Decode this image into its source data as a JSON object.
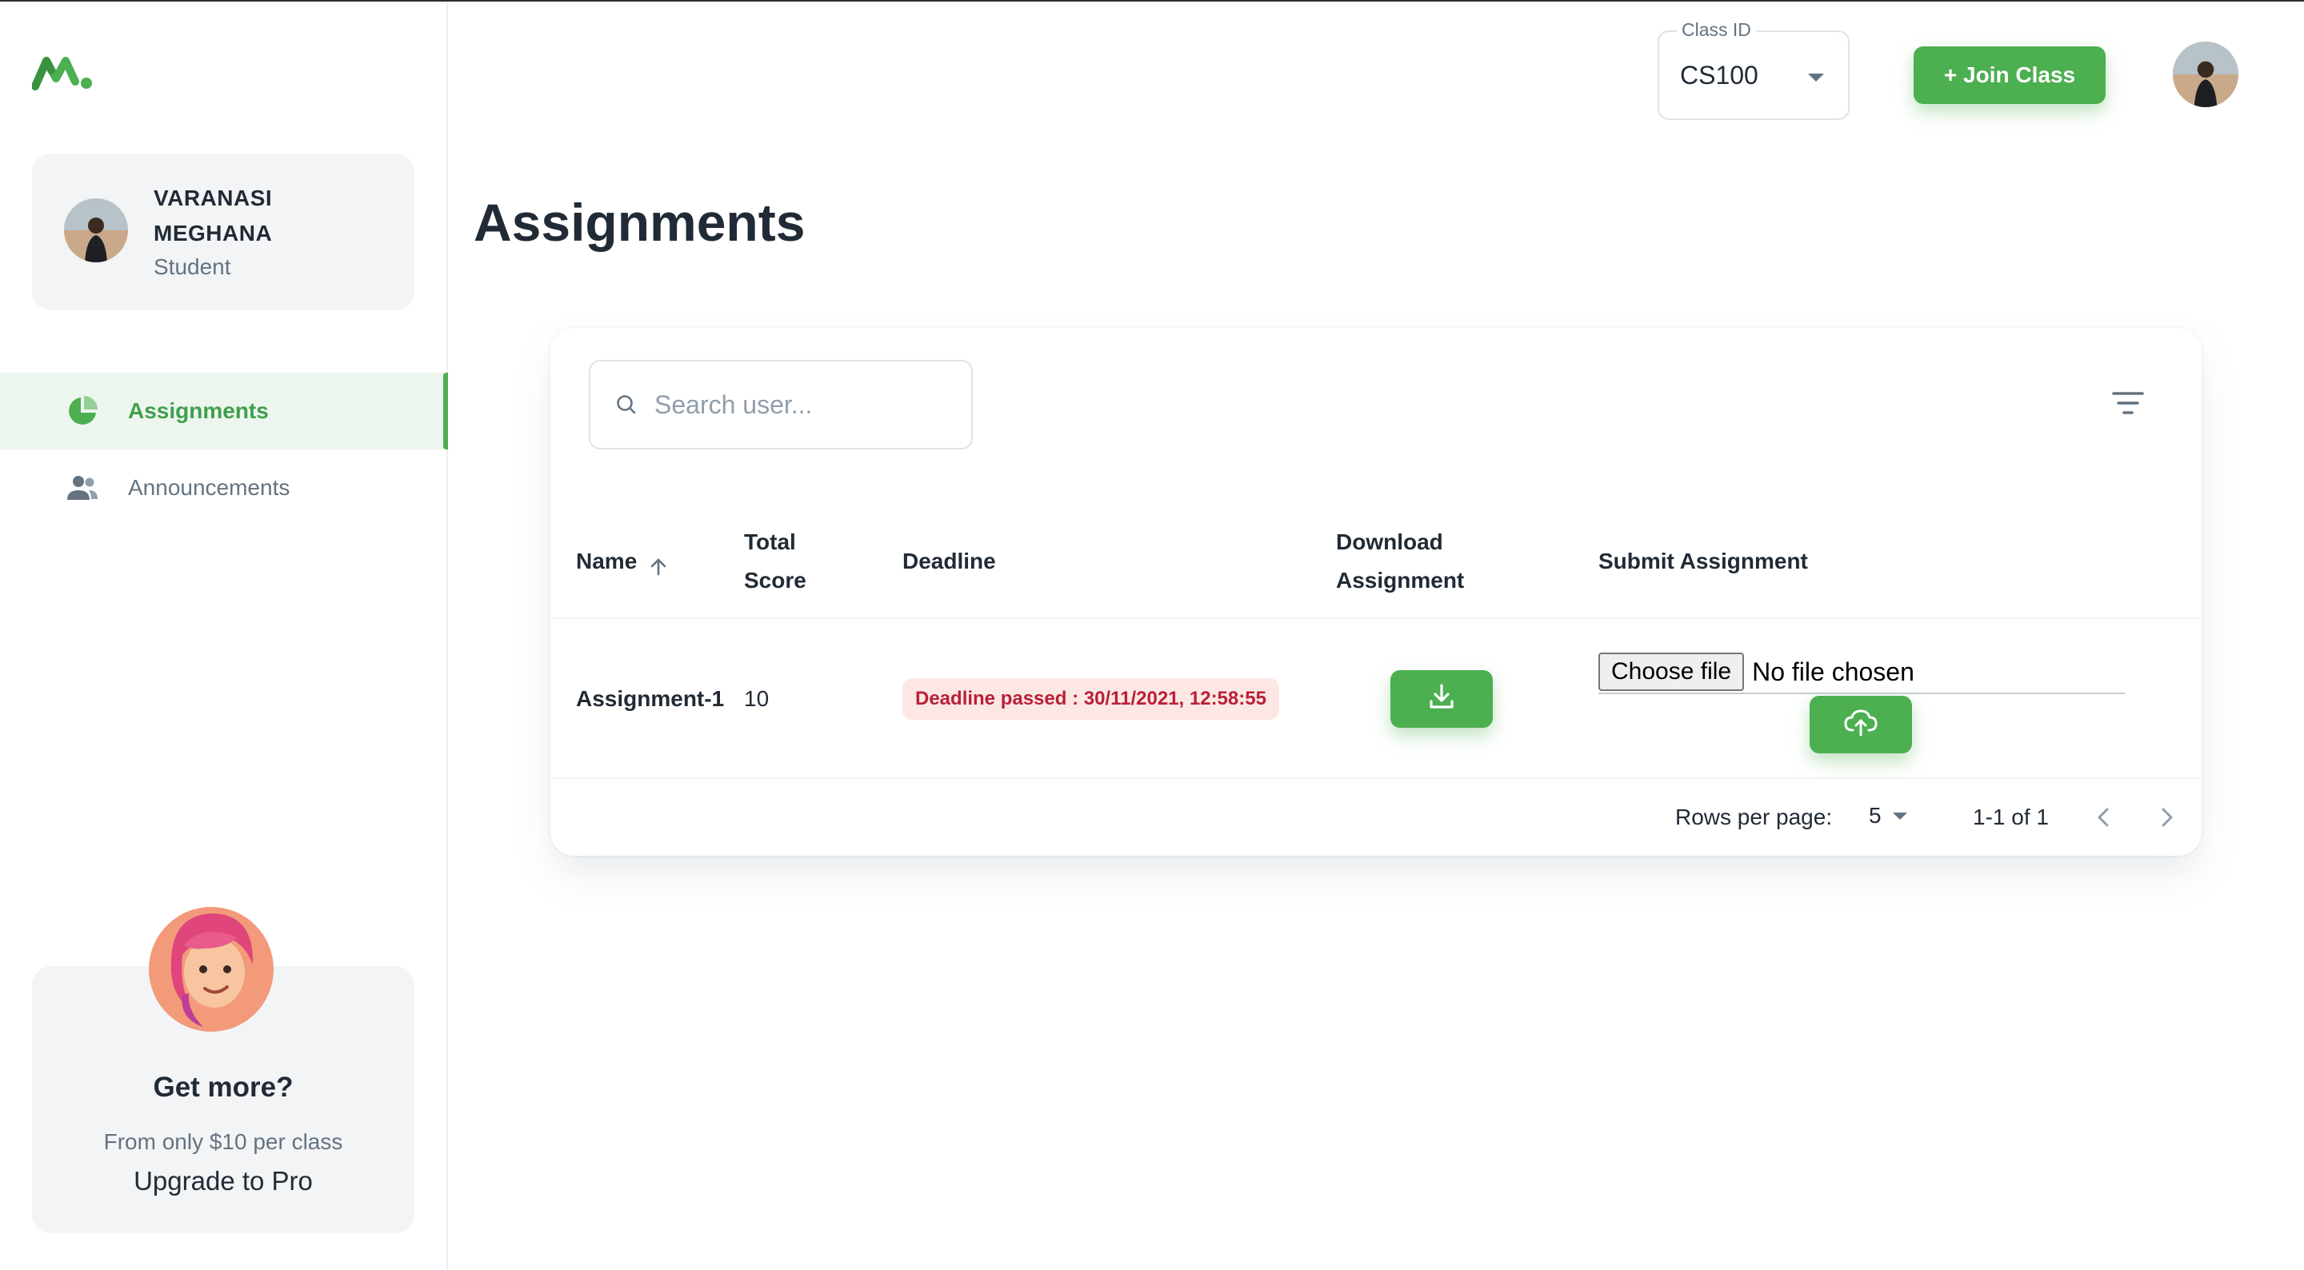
{
  "colors": {
    "brand": "#4caf50",
    "danger_text": "#b72136",
    "danger_bg": "#fde7e5"
  },
  "account": {
    "name": "VARANASI MEGHANA",
    "role": "Student"
  },
  "nav": {
    "items": [
      {
        "label": "Assignments",
        "icon": "pie-chart-icon",
        "active": true
      },
      {
        "label": "Announcements",
        "icon": "people-icon",
        "active": false
      }
    ]
  },
  "promo": {
    "title": "Get more?",
    "subtitle": "From only $10 per class",
    "cta": "Upgrade to Pro"
  },
  "header": {
    "class_id_label": "Class ID",
    "class_id_value": "CS100",
    "join_button": "+ Join Class"
  },
  "page": {
    "title": "Assignments"
  },
  "search": {
    "placeholder": "Search user..."
  },
  "table": {
    "columns": {
      "name": "Name",
      "total_score_1": "Total",
      "total_score_2": "Score",
      "deadline": "Deadline",
      "download_1": "Download",
      "download_2": "Assignment",
      "submit": "Submit Assignment"
    },
    "rows": [
      {
        "name": "Assignment-1",
        "total_score": "10",
        "deadline": "Deadline passed : 30/11/2021, 12:58:55",
        "file_button": "Choose file",
        "file_status": "No file chosen"
      }
    ]
  },
  "pagination": {
    "rows_per_page_label": "Rows per page:",
    "rows_per_page": "5",
    "range": "1-1 of 1"
  }
}
